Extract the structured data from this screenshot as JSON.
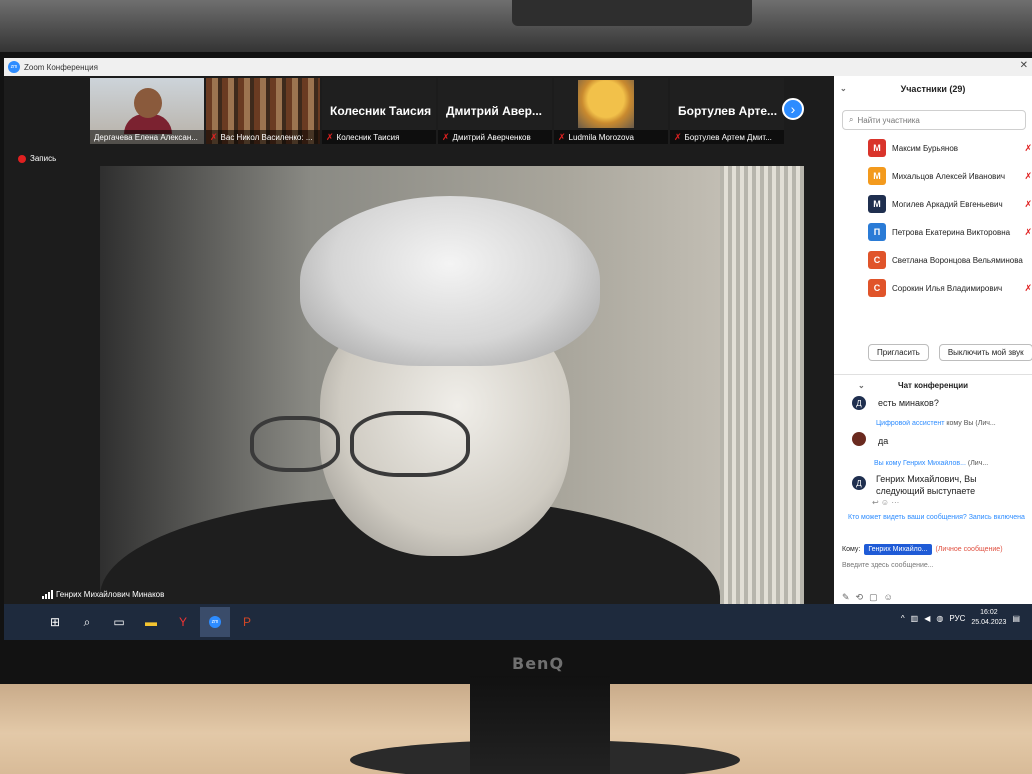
{
  "window": {
    "title": "Zoom Конференция",
    "close_glyph": "✕"
  },
  "thumbnails": [
    {
      "label": "Дергачева Елена Алексан...",
      "muted": false,
      "kind": "photo-person"
    },
    {
      "label": "Вас Никол Василенко: ...",
      "muted": true,
      "kind": "photo-shelves"
    },
    {
      "big_name": "Колесник Таисия",
      "label": "Колесник Таисия",
      "muted": true,
      "kind": "name-only"
    },
    {
      "big_name": "Дмитрий Авер...",
      "label": "Дмитрий Аверченков",
      "muted": true,
      "kind": "name-only"
    },
    {
      "label": "Ludmila Morozova",
      "muted": true,
      "kind": "photo-avatar"
    },
    {
      "big_name": "Бортулев Арте...",
      "label": "Бортулев Артем Дмит...",
      "muted": true,
      "kind": "name-only"
    }
  ],
  "next_glyph": "›",
  "recording": {
    "label": "Запись"
  },
  "active_speaker": {
    "name": "Генрих Михайлович Минаков"
  },
  "participants": {
    "header": "Участники (29)",
    "search_placeholder": "Найти участника",
    "items": [
      {
        "initial": "М",
        "name": "Максим Бурьянов",
        "color": "#d9342b",
        "muted": true
      },
      {
        "initial": "М",
        "name": "Михальцов Алексей Иванович",
        "color": "#f39a1d",
        "muted": true
      },
      {
        "initial": "М",
        "name": "Могилев Аркадий Евгеньевич",
        "color": "#1f2f4f",
        "muted": true
      },
      {
        "initial": "П",
        "name": "Петрова Екатерина Викторовна",
        "color": "#2a7bd6",
        "muted": true
      },
      {
        "initial": "С",
        "name": "Светлана Воронцова Вельяминова",
        "color": "#e0542a",
        "muted": false
      },
      {
        "initial": "С",
        "name": "Сорокин Илья Владимирович",
        "color": "#e0542a",
        "muted": true
      }
    ],
    "invite_label": "Пригласить",
    "mute_me_label": "Выключить мой звук"
  },
  "chat": {
    "header": "Чат конференции",
    "messages": [
      {
        "avatar": "Д",
        "text": "есть минаков?"
      },
      {
        "sender": "Цифровой ассистент",
        "to": "кому Вы (Лич...",
        "text": "да"
      },
      {
        "avatar": "Д",
        "sender": "Вы кому Генрих Михайлов...",
        "to": "(Лич...",
        "text_line1": "Генрих Михайлович, Вы",
        "text_line2": "следующий выступаете"
      }
    ],
    "notice": "Кто может видеть ваши сообщения? Запись включена",
    "to_label": "Кому:",
    "recipient": "Генрих Михайло...",
    "private_label": "(Личное сообщение)",
    "compose_placeholder": "Введите здесь сообщение..."
  },
  "taskbar": {
    "time": "16:02",
    "date": "25.04.2023",
    "lang": "РУС"
  },
  "monitor_brand": "BenQ"
}
